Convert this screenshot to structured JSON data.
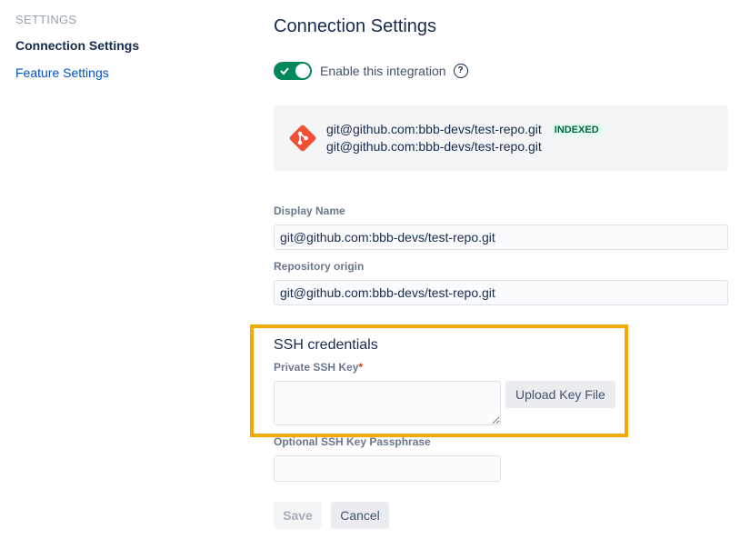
{
  "sidebar": {
    "heading": "SETTINGS",
    "items": [
      {
        "label": "Connection Settings",
        "active": true
      },
      {
        "label": "Feature Settings",
        "active": false
      }
    ]
  },
  "main": {
    "title": "Connection Settings",
    "toggle": {
      "label": "Enable this integration",
      "enabled": true,
      "help_icon": "help-circle-icon"
    },
    "repo": {
      "icon": "git-logo-icon",
      "name": "git@github.com:bbb-devs/test-repo.git",
      "badge": "INDEXED",
      "origin": "git@github.com:bbb-devs/test-repo.git"
    },
    "display_name": {
      "label": "Display Name",
      "value": "git@github.com:bbb-devs/test-repo.git"
    },
    "repository_origin": {
      "label": "Repository origin",
      "value": "git@github.com:bbb-devs/test-repo.git"
    },
    "ssh": {
      "title": "SSH credentials",
      "private_key_label": "Private SSH Key",
      "required_mark": "*",
      "private_key_value": "",
      "upload_button": "Upload Key File",
      "passphrase_label": "Optional SSH Key Passphrase",
      "passphrase_value": ""
    },
    "actions": {
      "save": "Save",
      "cancel": "Cancel"
    }
  },
  "colors": {
    "accent": "#00875a",
    "link": "#0052cc",
    "highlight": "#f2a900",
    "git_logo": "#f05033",
    "required": "#de350b"
  }
}
